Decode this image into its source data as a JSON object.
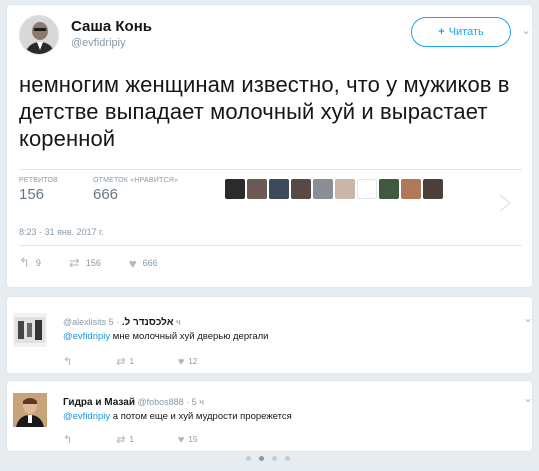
{
  "tweet": {
    "author_name": "Саша Конь",
    "author_handle": "@evfidripiy",
    "follow_label": "Читать",
    "text": "немногим женщинам известно, что у мужиков в детстве выпадает молочный хуй и вырастает коренной",
    "retweets_label": "РЕТВИТОВ",
    "retweets_count": "156",
    "likes_label": "ОТМЕТОК «НРАВИТСЯ»",
    "likes_count": "666",
    "datetime": "8:23 - 31 янв. 2017 г.",
    "actions": {
      "reply_count": "9",
      "retweet_count": "156",
      "like_count": "666"
    },
    "liker_colors": [
      "#2b2b2b",
      "#6b5a55",
      "#3d4a5a",
      "#574a44",
      "#8a8f96",
      "#c9b6a8",
      "#ffffff",
      "#3f5a3f",
      "#b07a5a",
      "#4b3f3a"
    ]
  },
  "replies": [
    {
      "author_name": "אלכסנדר ל.",
      "author_handle": "@alexlisits",
      "time": "· 5 ч",
      "mention": "@evfidripiy",
      "text": "мне молочный хуй дверью дергали",
      "reply_count": "",
      "retweet_count": "1",
      "like_count": "12"
    },
    {
      "author_name": "Гидра и Мазай",
      "author_handle": "@fobos888",
      "time": "· 5 ч",
      "mention": "@evfidripiy",
      "text": "а потом еще и хуй мудрости прорежется",
      "reply_count": "",
      "retweet_count": "1",
      "like_count": "15"
    }
  ],
  "icons": {
    "reply": "↰",
    "retweet": "⇄",
    "like": "♥",
    "follow": "+",
    "chevron": "⌄"
  },
  "pagination": {
    "total": 4,
    "active": 1
  }
}
